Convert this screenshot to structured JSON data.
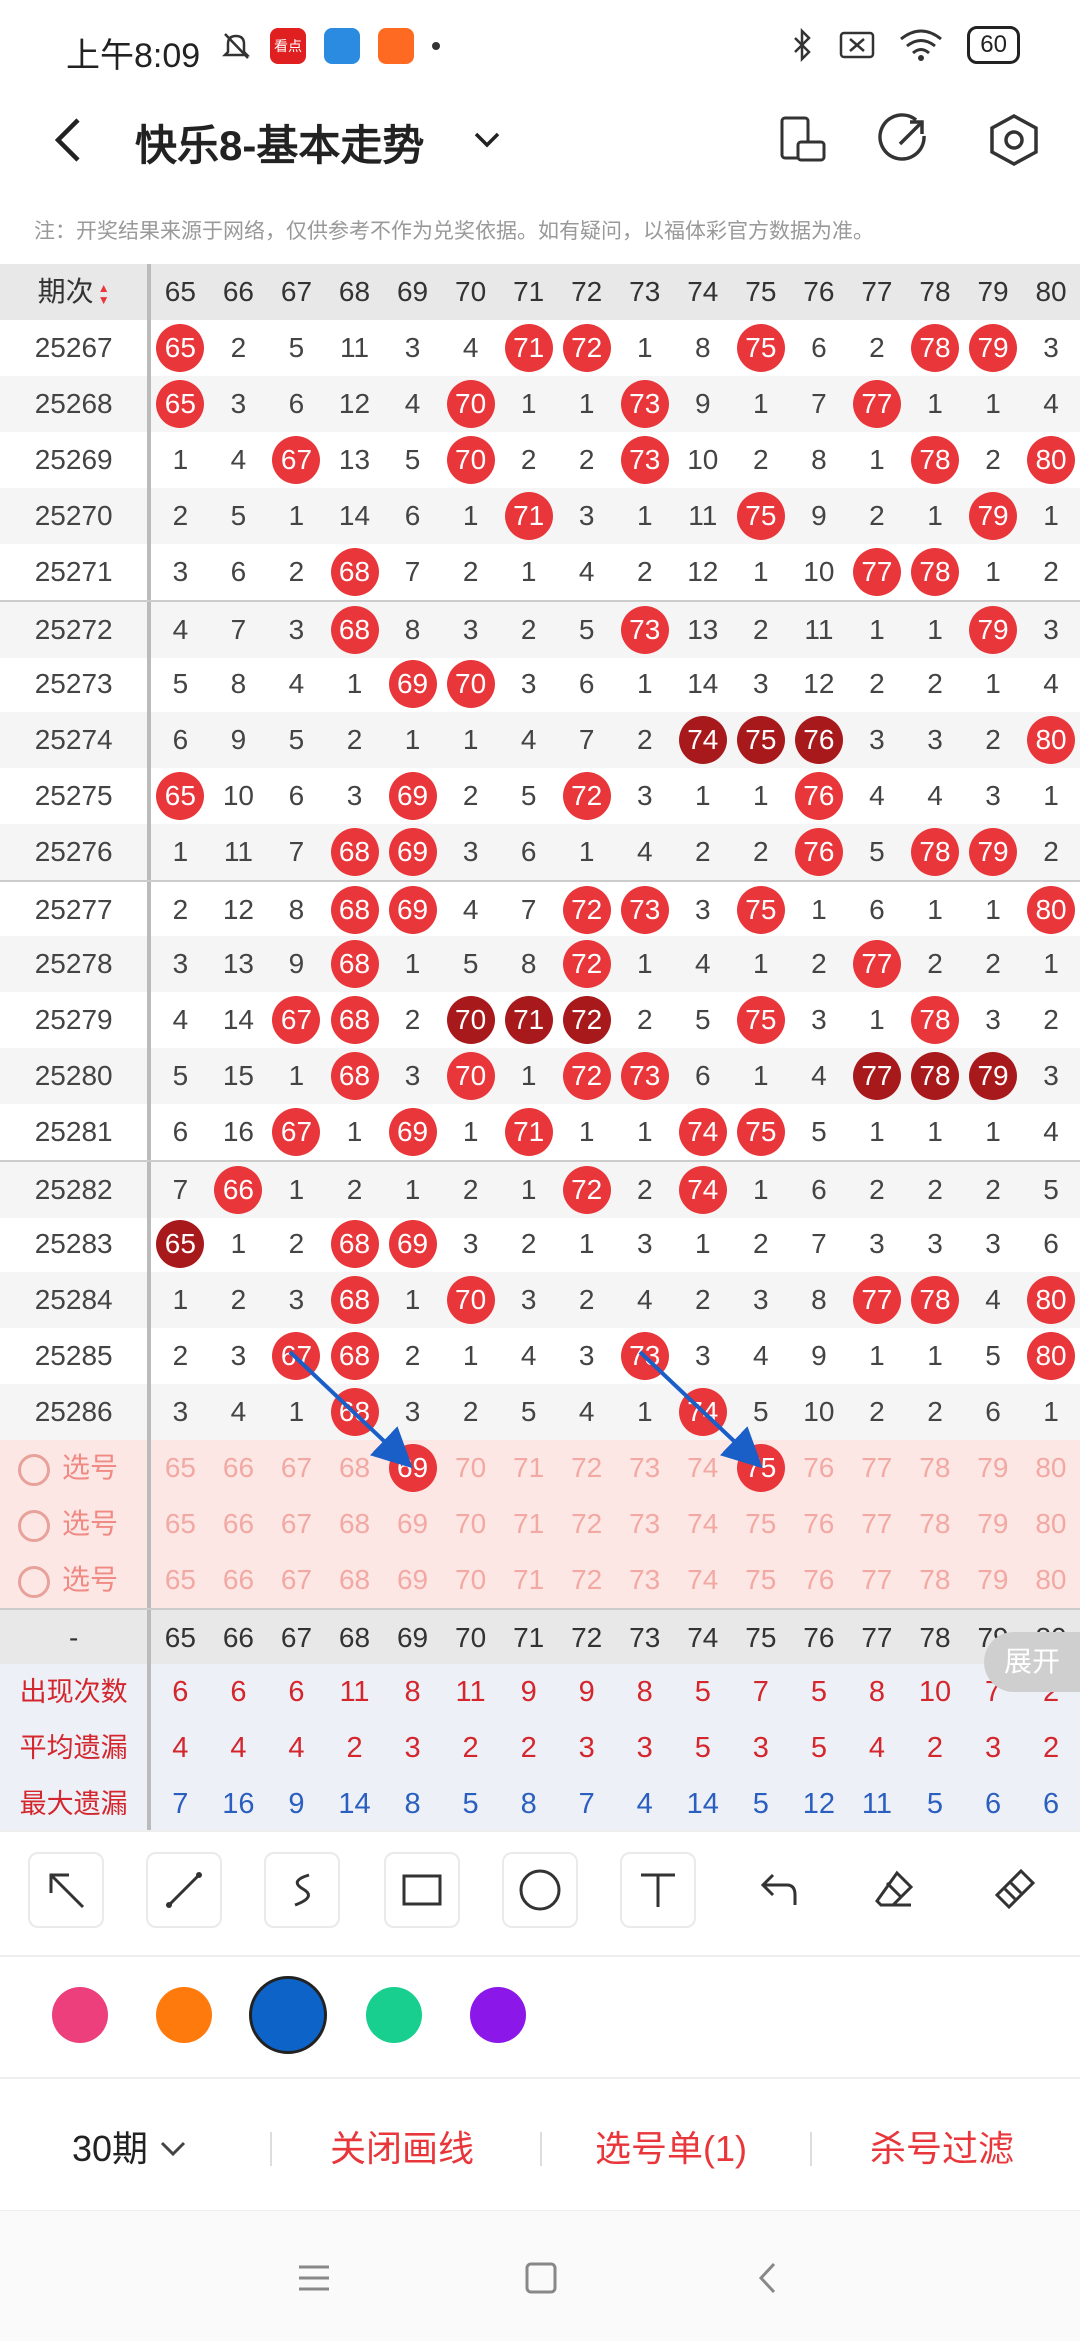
{
  "status": {
    "time": "上午8:09",
    "battery": "60",
    "apps": [
      "看点",
      "",
      ""
    ]
  },
  "app": {
    "title": "快乐8-基本走势"
  },
  "notice": "注：开奖结果来源于网络，仅供参考不作为兑奖依据。如有疑问，以福体彩官方数据为准。",
  "table": {
    "period_header": "期次",
    "columns": [
      "65",
      "66",
      "67",
      "68",
      "69",
      "70",
      "71",
      "72",
      "73",
      "74",
      "75",
      "76",
      "77",
      "78",
      "79",
      "80"
    ],
    "rows": [
      {
        "p": "25267",
        "v": [
          "65",
          "2",
          "5",
          "11",
          "3",
          "4",
          "71",
          "72",
          "1",
          "8",
          "75",
          "6",
          "2",
          "78",
          "79",
          "3"
        ],
        "h": [
          0,
          6,
          7,
          10,
          13,
          14
        ],
        "d": []
      },
      {
        "p": "25268",
        "v": [
          "65",
          "3",
          "6",
          "12",
          "4",
          "70",
          "1",
          "1",
          "73",
          "9",
          "1",
          "7",
          "77",
          "1",
          "1",
          "4"
        ],
        "h": [
          0,
          5,
          8,
          12
        ],
        "d": []
      },
      {
        "p": "25269",
        "v": [
          "1",
          "4",
          "67",
          "13",
          "5",
          "70",
          "2",
          "2",
          "73",
          "10",
          "2",
          "8",
          "1",
          "78",
          "2",
          "80"
        ],
        "h": [
          2,
          5,
          8,
          13,
          15
        ],
        "d": []
      },
      {
        "p": "25270",
        "v": [
          "2",
          "5",
          "1",
          "14",
          "6",
          "1",
          "71",
          "3",
          "1",
          "11",
          "75",
          "9",
          "2",
          "1",
          "79",
          "1"
        ],
        "h": [
          6,
          10,
          14
        ],
        "d": []
      },
      {
        "p": "25271",
        "v": [
          "3",
          "6",
          "2",
          "68",
          "7",
          "2",
          "1",
          "4",
          "2",
          "12",
          "1",
          "10",
          "77",
          "78",
          "1",
          "2"
        ],
        "h": [
          3,
          12,
          13
        ],
        "d": []
      },
      {
        "p": "25272",
        "v": [
          "4",
          "7",
          "3",
          "68",
          "8",
          "3",
          "2",
          "5",
          "73",
          "13",
          "2",
          "11",
          "1",
          "1",
          "79",
          "3"
        ],
        "h": [
          3,
          8,
          14
        ],
        "d": []
      },
      {
        "p": "25273",
        "v": [
          "5",
          "8",
          "4",
          "1",
          "69",
          "70",
          "3",
          "6",
          "1",
          "14",
          "3",
          "12",
          "2",
          "2",
          "1",
          "4"
        ],
        "h": [
          4,
          5
        ],
        "d": []
      },
      {
        "p": "25274",
        "v": [
          "6",
          "9",
          "5",
          "2",
          "1",
          "1",
          "4",
          "7",
          "2",
          "74",
          "75",
          "76",
          "3",
          "3",
          "2",
          "80"
        ],
        "h": [
          15
        ],
        "d": [
          9,
          10,
          11
        ]
      },
      {
        "p": "25275",
        "v": [
          "65",
          "10",
          "6",
          "3",
          "69",
          "2",
          "5",
          "72",
          "3",
          "1",
          "1",
          "76",
          "4",
          "4",
          "3",
          "1"
        ],
        "h": [
          0,
          4,
          7,
          11
        ],
        "d": []
      },
      {
        "p": "25276",
        "v": [
          "1",
          "11",
          "7",
          "68",
          "69",
          "3",
          "6",
          "1",
          "4",
          "2",
          "2",
          "76",
          "5",
          "78",
          "79",
          "2"
        ],
        "h": [
          3,
          4,
          11,
          13,
          14
        ],
        "d": []
      },
      {
        "p": "25277",
        "v": [
          "2",
          "12",
          "8",
          "68",
          "69",
          "4",
          "7",
          "72",
          "73",
          "3",
          "75",
          "1",
          "6",
          "1",
          "1",
          "80"
        ],
        "h": [
          3,
          4,
          7,
          8,
          10,
          15
        ],
        "d": []
      },
      {
        "p": "25278",
        "v": [
          "3",
          "13",
          "9",
          "68",
          "1",
          "5",
          "8",
          "72",
          "1",
          "4",
          "1",
          "2",
          "77",
          "2",
          "2",
          "1"
        ],
        "h": [
          3,
          7,
          12
        ],
        "d": []
      },
      {
        "p": "25279",
        "v": [
          "4",
          "14",
          "67",
          "68",
          "2",
          "70",
          "71",
          "72",
          "2",
          "5",
          "75",
          "3",
          "1",
          "78",
          "3",
          "2"
        ],
        "h": [
          2,
          3,
          10,
          13
        ],
        "d": [
          5,
          6,
          7
        ]
      },
      {
        "p": "25280",
        "v": [
          "5",
          "15",
          "1",
          "68",
          "3",
          "70",
          "1",
          "72",
          "73",
          "6",
          "1",
          "4",
          "77",
          "78",
          "79",
          "3"
        ],
        "h": [
          3,
          5,
          7,
          8
        ],
        "d": [
          12,
          13,
          14
        ]
      },
      {
        "p": "25281",
        "v": [
          "6",
          "16",
          "67",
          "1",
          "69",
          "1",
          "71",
          "1",
          "1",
          "74",
          "75",
          "5",
          "1",
          "1",
          "1",
          "4"
        ],
        "h": [
          2,
          4,
          6,
          9,
          10
        ],
        "d": []
      },
      {
        "p": "25282",
        "v": [
          "7",
          "66",
          "1",
          "2",
          "1",
          "2",
          "1",
          "72",
          "2",
          "74",
          "1",
          "6",
          "2",
          "2",
          "2",
          "5"
        ],
        "h": [
          1,
          7,
          9
        ],
        "d": []
      },
      {
        "p": "25283",
        "v": [
          "65",
          "1",
          "2",
          "68",
          "69",
          "3",
          "2",
          "1",
          "3",
          "1",
          "2",
          "7",
          "3",
          "3",
          "3",
          "6"
        ],
        "h": [
          3,
          4
        ],
        "d": [
          0
        ]
      },
      {
        "p": "25284",
        "v": [
          "1",
          "2",
          "3",
          "68",
          "1",
          "70",
          "3",
          "2",
          "4",
          "2",
          "3",
          "8",
          "77",
          "78",
          "4",
          "80"
        ],
        "h": [
          3,
          5,
          12,
          13,
          15
        ],
        "d": []
      },
      {
        "p": "25285",
        "v": [
          "2",
          "3",
          "67",
          "68",
          "2",
          "1",
          "4",
          "3",
          "73",
          "3",
          "4",
          "9",
          "1",
          "1",
          "5",
          "80"
        ],
        "h": [
          2,
          3,
          8,
          15
        ],
        "d": []
      },
      {
        "p": "25286",
        "v": [
          "3",
          "4",
          "1",
          "68",
          "3",
          "2",
          "5",
          "4",
          "1",
          "74",
          "5",
          "10",
          "2",
          "2",
          "6",
          "1"
        ],
        "h": [
          3,
          9
        ],
        "d": []
      }
    ],
    "select_label": "选号",
    "select_marked": {
      "row": 0,
      "cols": [
        4,
        10
      ]
    },
    "footer_dash": "-",
    "stats": [
      {
        "label": "出现次数",
        "values": [
          "6",
          "6",
          "6",
          "11",
          "8",
          "11",
          "9",
          "9",
          "8",
          "5",
          "7",
          "5",
          "8",
          "10",
          "7",
          "2"
        ]
      },
      {
        "label": "平均遗漏",
        "values": [
          "4",
          "4",
          "4",
          "2",
          "3",
          "2",
          "2",
          "3",
          "3",
          "5",
          "3",
          "5",
          "4",
          "2",
          "3",
          "2"
        ]
      },
      {
        "label": "最大遗漏",
        "values": [
          "7",
          "16",
          "9",
          "14",
          "8",
          "5",
          "8",
          "7",
          "4",
          "14",
          "5",
          "12",
          "11",
          "5",
          "6",
          "6"
        ]
      }
    ],
    "expand_label": "展开"
  },
  "colors": [
    "#ec3f7c",
    "#ff7a0c",
    "#0d63c7",
    "#18cf8f",
    "#8b17e8"
  ],
  "bottom": {
    "period_select": "30期",
    "close_draw": "关闭画线",
    "pick_list": "选号单(1)",
    "filter": "杀号过滤"
  }
}
